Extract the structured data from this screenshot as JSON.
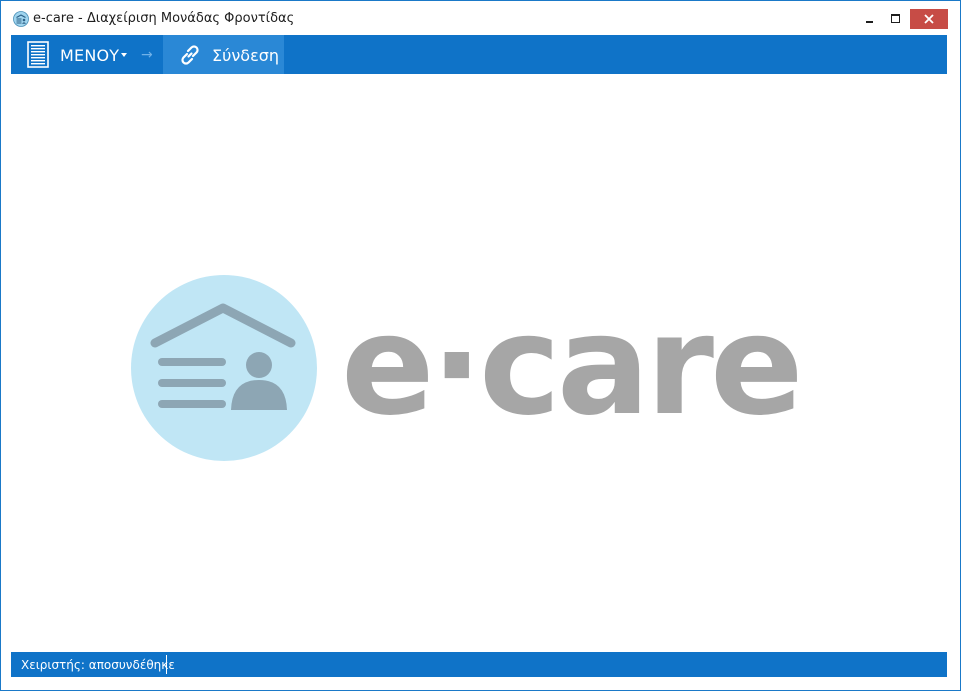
{
  "window": {
    "title": "e-care - Διαχείριση Μονάδας Φροντίδας",
    "controls": {
      "minimize": "minimize",
      "maximize": "maximize",
      "close": "close"
    }
  },
  "toolbar": {
    "menu_label": "ΜΕΝΟΥ",
    "separator_arrow": "→",
    "connect_label": "Σύνδεση"
  },
  "logo": {
    "text": "e·care"
  },
  "statusbar": {
    "operator_status": "Χειριστής: αποσυνδέθηκε"
  },
  "colors": {
    "accent": "#0f73c8",
    "accent_active": "#2a88d6",
    "close_button": "#c74c46",
    "logo_circle": "#c0e6f5",
    "logo_gray": "#a6a6a6"
  },
  "icons": {
    "app": "e-care-app-icon",
    "menu": "document-icon",
    "connect": "link-icon"
  }
}
